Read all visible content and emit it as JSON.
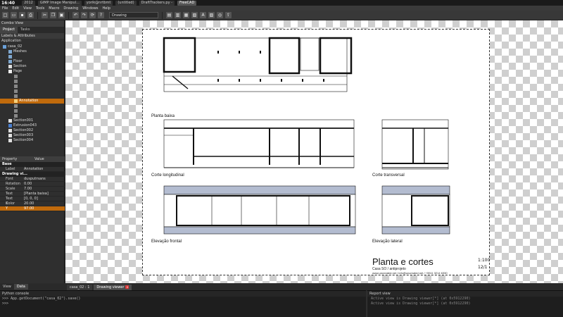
{
  "taskbar": {
    "clock": "16:40",
    "items": [
      "2012",
      "GIMP Image Manipul...",
      "yorik@nrtbmt",
      "(untitled)",
      "DraftTrackers.py -",
      "FreeCAD"
    ]
  },
  "menu": [
    "File",
    "Edit",
    "View",
    "Tools",
    "Macro",
    "Drawing",
    "Windows",
    "Help"
  ],
  "toolbar": {
    "workbench": "Drawing"
  },
  "combo": {
    "title": "Combo View",
    "tabs": [
      "Project",
      "Tasks"
    ],
    "section": "Labels & Attributes",
    "app_label": "Application",
    "tree": [
      {
        "label": "casa_02",
        "depth": 0,
        "icon": "document-icon",
        "state": "normal"
      },
      {
        "label": "Meshes",
        "depth": 1,
        "icon": "folder-icon",
        "state": "normal"
      },
      {
        "label": "",
        "depth": 1,
        "icon": "folder-icon",
        "state": "dim"
      },
      {
        "label": "Floor",
        "depth": 1,
        "icon": "folder-icon",
        "state": "normal"
      },
      {
        "label": "Section",
        "depth": 1,
        "icon": "section-icon",
        "state": "normal"
      },
      {
        "label": "Page",
        "depth": 1,
        "icon": "page-icon",
        "state": "normal"
      },
      {
        "label": "",
        "depth": 2,
        "icon": "view-icon",
        "state": "dim"
      },
      {
        "label": "",
        "depth": 2,
        "icon": "view-icon",
        "state": "dim"
      },
      {
        "label": "",
        "depth": 2,
        "icon": "view-icon",
        "state": "dim"
      },
      {
        "label": "",
        "depth": 2,
        "icon": "view-icon",
        "state": "dim"
      },
      {
        "label": "",
        "depth": 2,
        "icon": "view-icon",
        "state": "dim"
      },
      {
        "label": "Annotation",
        "depth": 2,
        "icon": "annotation-icon",
        "state": "selected"
      },
      {
        "label": "",
        "depth": 2,
        "icon": "view-icon",
        "state": "dim"
      },
      {
        "label": "",
        "depth": 2,
        "icon": "view-icon",
        "state": "dim"
      },
      {
        "label": "",
        "depth": 2,
        "icon": "view-icon",
        "state": "dim"
      },
      {
        "label": "Section001",
        "depth": 1,
        "icon": "section-icon",
        "state": "normal"
      },
      {
        "label": "Extrusion043",
        "depth": 1,
        "icon": "extrusion-icon",
        "state": "normal"
      },
      {
        "label": "Section002",
        "depth": 1,
        "icon": "section-icon",
        "state": "normal"
      },
      {
        "label": "Section003",
        "depth": 1,
        "icon": "section-icon",
        "state": "normal"
      },
      {
        "label": "Section004",
        "depth": 1,
        "icon": "section-icon",
        "state": "normal"
      }
    ]
  },
  "properties": {
    "headers": [
      "Property",
      "Value"
    ],
    "groups": [
      {
        "name": "Base",
        "rows": [
          {
            "key": "Label",
            "value": "Annotation",
            "highlight": false
          }
        ]
      },
      {
        "name": "Drawing vi...",
        "rows": [
          {
            "key": "Font",
            "value": "dusputrsans",
            "highlight": false
          },
          {
            "key": "Rotation",
            "value": "0.00",
            "highlight": false
          },
          {
            "key": "Scale",
            "value": "7.00",
            "highlight": false
          },
          {
            "key": "Text",
            "value": "[Planta baixa]",
            "highlight": false
          },
          {
            "key": "Text Color",
            "value": "[0, 0, 0]",
            "highlight": false
          },
          {
            "key": "X",
            "value": "20.00",
            "highlight": false
          },
          {
            "key": "Y",
            "value": "97.00",
            "highlight": true
          }
        ]
      }
    ]
  },
  "view_tabs": [
    "View",
    "Data"
  ],
  "drawing": {
    "labels": {
      "planta": "Planta baixa",
      "corte_long": "Corte longitudinal",
      "corte_trans": "Corte transversal",
      "elev_frontal": "Elevação frontal",
      "elev_lateral": "Elevação lateral"
    },
    "title_block": {
      "title": "Planta e cortes",
      "subtitle": "Casa SO / antiprojeto",
      "contact": "www.uncreated.net / info@uncreated.net / +5511 3214 6330",
      "scale": "1:100",
      "date": "12/1"
    }
  },
  "doc_tabs": [
    {
      "label": "casa_02 : 1",
      "active": false
    },
    {
      "label": "Drawing viewer",
      "active": true
    }
  ],
  "console": {
    "title": "Python console",
    "lines": [
      ">>> App.getDocument(\"casa_02\").save()",
      ">>>"
    ]
  },
  "report": {
    "title": "Report view",
    "lines": [
      "Active view is Drawing viewer[*] (at 0x5912290)",
      "Active view is Drawing viewer[*] (at 0x5912290)"
    ]
  },
  "colors": {
    "selection": "#c06a0c",
    "bg_dark": "#2b2b2b",
    "elevation_fill": "#b3bcd0"
  }
}
